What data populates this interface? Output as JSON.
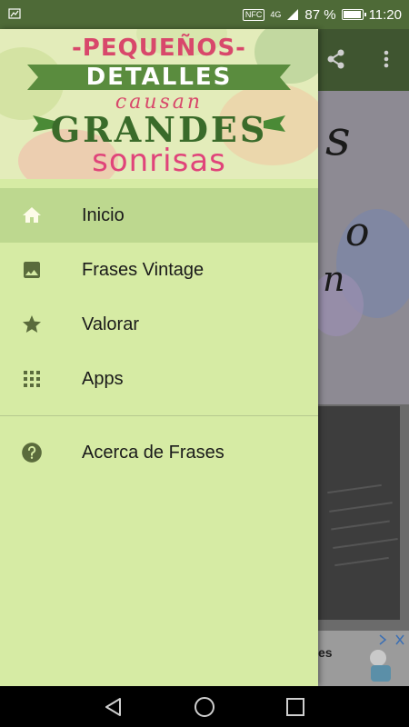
{
  "status_bar": {
    "nfc": "NFC",
    "network": "4G",
    "battery_percent": "87 %",
    "battery_level": 0.87,
    "time": "11:20",
    "icons": [
      "notification-flag-icon",
      "nfc-icon",
      "signal-icon",
      "battery-icon"
    ]
  },
  "header_image": {
    "line1": "-PEQUEÑOS-",
    "line2": "DETALLES",
    "line3": "causan",
    "line4": "GRANDES",
    "line5": "sonrisas"
  },
  "drawer": {
    "items": [
      {
        "label": "Inicio",
        "icon": "home-icon",
        "active": true
      },
      {
        "label": "Frases Vintage",
        "icon": "image-icon",
        "active": false
      },
      {
        "label": "Valorar",
        "icon": "star-icon",
        "active": false
      },
      {
        "label": "Apps",
        "icon": "apps-grid-icon",
        "active": false
      }
    ],
    "secondary_items": [
      {
        "label": "Acerca de Frases",
        "icon": "help-icon"
      }
    ]
  },
  "background_app": {
    "ad_text": "es",
    "toolbar_icons": [
      "share-icon",
      "overflow-menu-icon"
    ]
  },
  "colors": {
    "drawer_background": "#d6eba4",
    "active_item": "#bdd88f",
    "status_bar": "#4e6a37",
    "toolbar": "#3f5530",
    "icon": "#5a6b3c"
  },
  "navigation": {
    "buttons": [
      "back-icon",
      "home-circle-icon",
      "recents-icon"
    ]
  }
}
